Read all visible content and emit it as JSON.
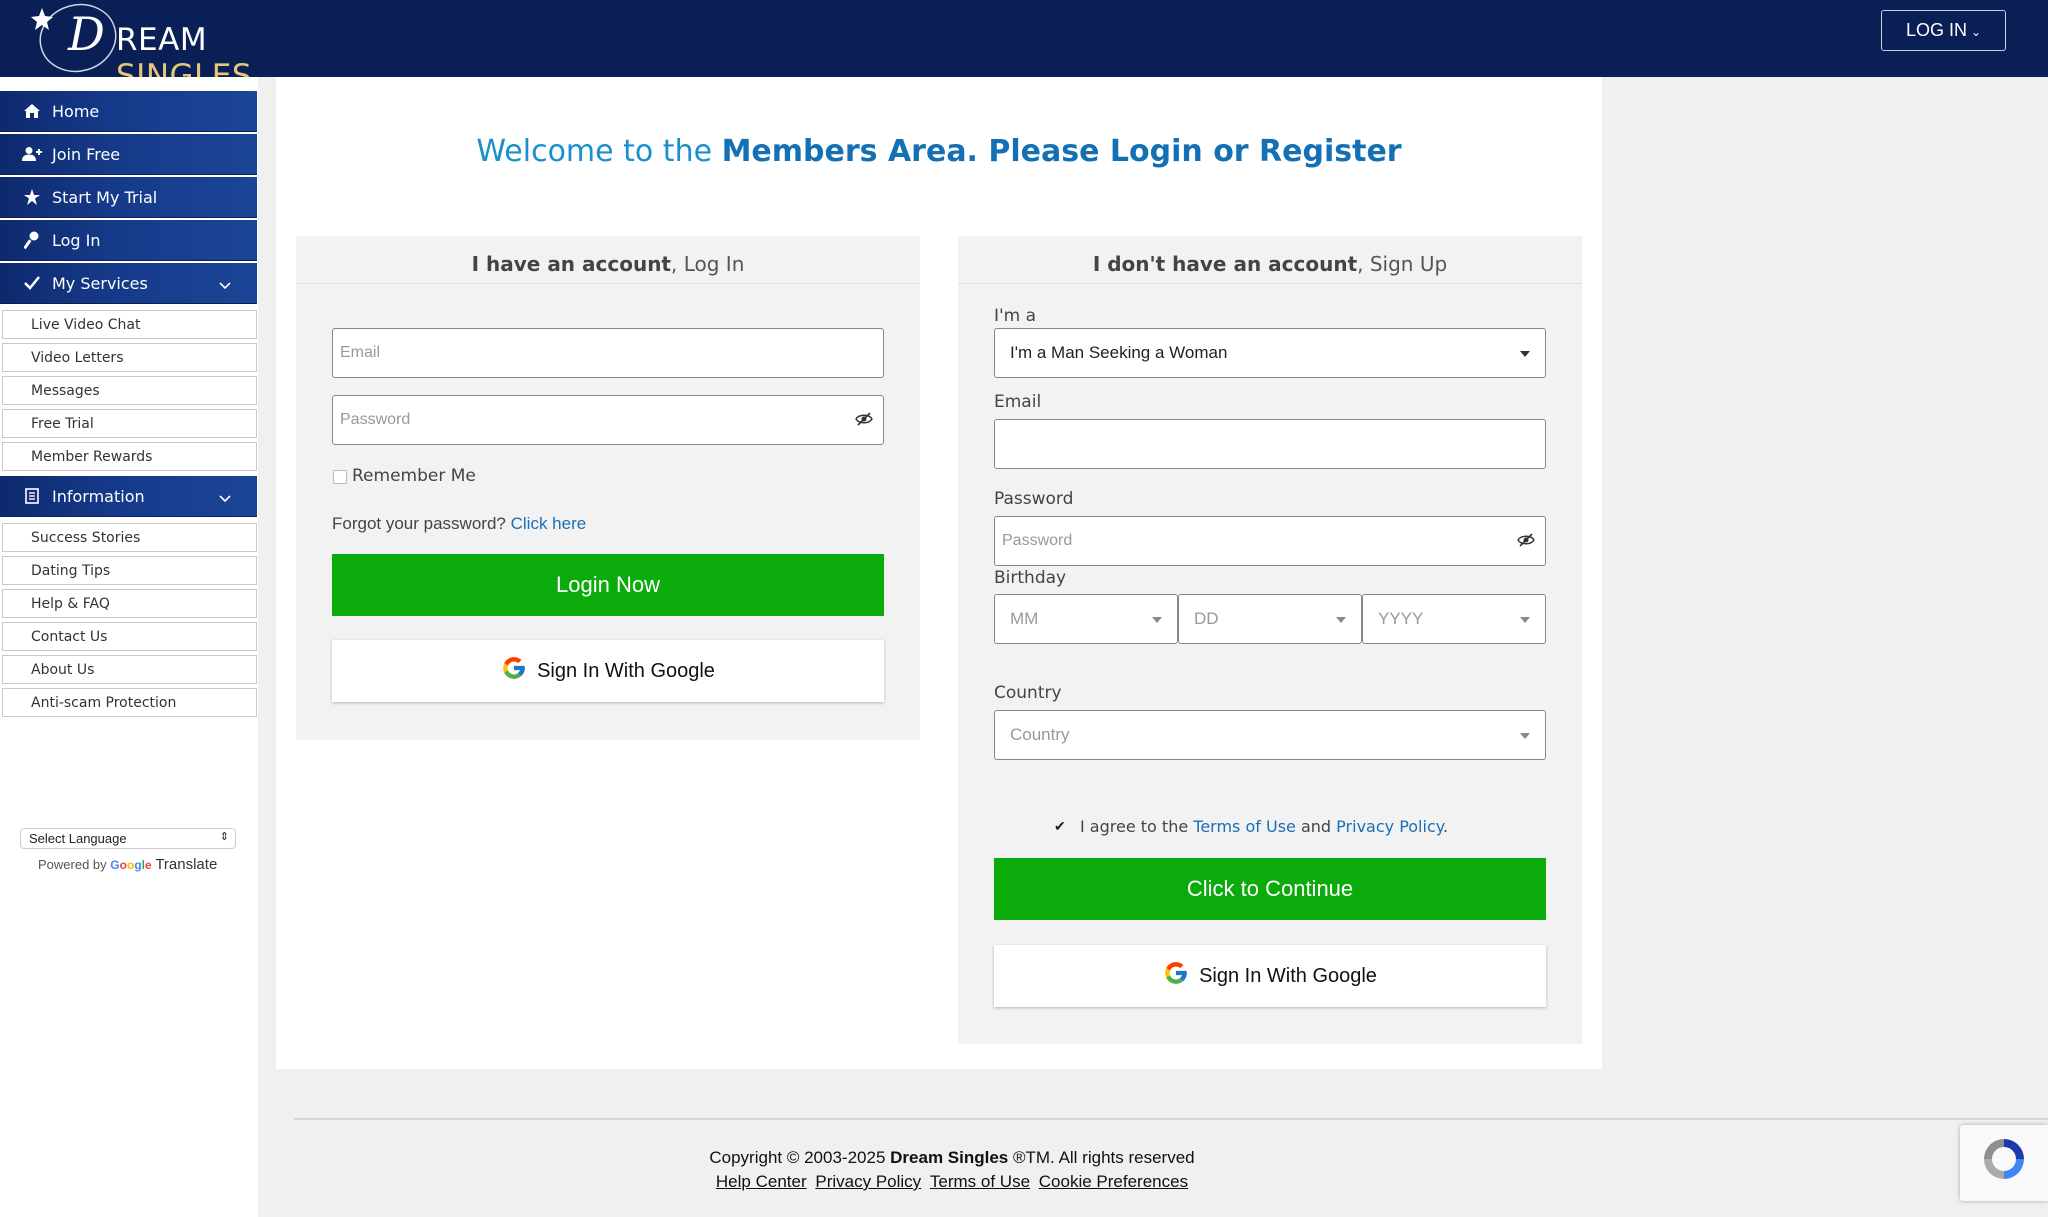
{
  "header": {
    "logo_part1": "REAM",
    "logo_part2": "SINGLES",
    "login_button": "LOG IN"
  },
  "sidebar": {
    "nav": [
      {
        "label": "Home",
        "icon": "home-icon"
      },
      {
        "label": "Join Free",
        "icon": "add-user-icon"
      },
      {
        "label": "Start My Trial",
        "icon": "star-icon"
      },
      {
        "label": "Log In",
        "icon": "key-icon"
      },
      {
        "label": "My Services",
        "icon": "check-icon"
      }
    ],
    "services": [
      "Live Video Chat",
      "Video Letters",
      "Messages",
      "Free Trial",
      "Member Rewards"
    ],
    "information_label": "Information",
    "information": [
      "Success Stories",
      "Dating Tips",
      "Help & FAQ",
      "Contact Us",
      "About Us",
      "Anti-scam Protection"
    ],
    "language_select": "Select Language",
    "powered_by": "Powered by",
    "google": "Google",
    "translate": "Translate"
  },
  "welcome": {
    "prefix": "Welcome to the ",
    "bold": "Members Area. Please Login or Register"
  },
  "login_panel": {
    "heading_bold": "I have an account",
    "heading_rest": ", Log In",
    "email_placeholder": "Email",
    "password_placeholder": "Password",
    "remember_me": "Remember Me",
    "forgot_text": "Forgot your password?",
    "forgot_link": "Click here",
    "login_button": "Login Now",
    "google_button": "Sign In With Google"
  },
  "signup_panel": {
    "heading_bold": "I don't have an account",
    "heading_rest": ", Sign Up",
    "im_a_label": "I'm a",
    "im_a_value": "I'm a Man Seeking a Woman",
    "email_label": "Email",
    "password_label": "Password",
    "password_placeholder": "Password",
    "birthday_label": "Birthday",
    "month": "MM",
    "day": "DD",
    "year": "YYYY",
    "country_label": "Country",
    "country_placeholder": "Country",
    "agree_text": "I agree to the",
    "terms": "Terms of Use",
    "and": "and",
    "privacy": "Privacy Policy",
    "period": ".",
    "agreed": true,
    "continue_button": "Click to Continue",
    "google_button": "Sign In With Google"
  },
  "footer": {
    "copyright_prefix": "Copyright © 2003-2025",
    "brand": "Dream Singles",
    "copyright_suffix": "®TM. All rights reserved",
    "links": [
      "Help Center",
      "Privacy Policy",
      "Terms of Use",
      "Cookie Preferences"
    ]
  },
  "colors": {
    "header_bg": "#0a1f55",
    "accent_blue": "#1a8fce",
    "green": "#0aab0a"
  }
}
